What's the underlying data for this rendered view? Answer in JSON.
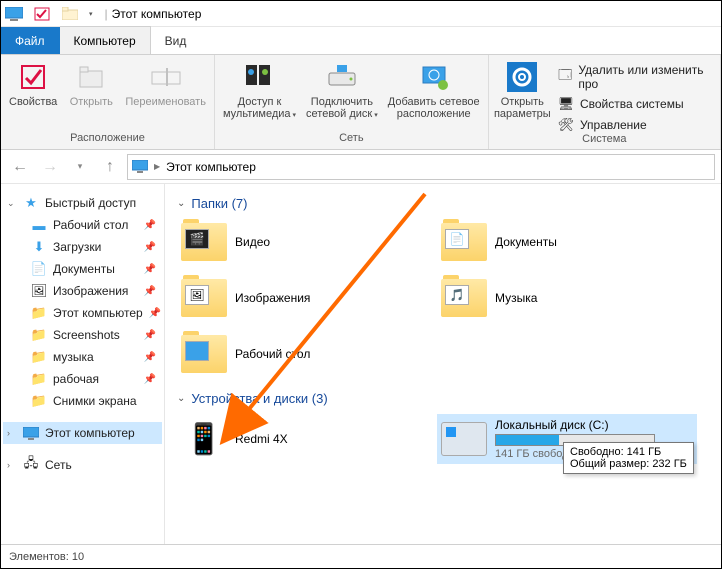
{
  "title": "Этот компьютер",
  "tabs": {
    "file": "Файл",
    "computer": "Компьютер",
    "view": "Вид"
  },
  "ribbon": {
    "group1": {
      "props": "Свойства",
      "open": "Открыть",
      "rename": "Переименовать",
      "label": "Расположение"
    },
    "group2": {
      "media": "Доступ к\nмультимедиа",
      "netdrive": "Подключить\nсетевой диск",
      "addnet": "Добавить сетевое\nрасположение",
      "label": "Сеть"
    },
    "group3": {
      "settings": "Открыть\nпараметры",
      "a": "Удалить или изменить про",
      "b": "Свойства системы",
      "c": "Управление",
      "label": "Система"
    }
  },
  "addr": {
    "root": "Этот компьютер"
  },
  "nav": {
    "quick": "Быстрый доступ",
    "desktop": "Рабочий стол",
    "downloads": "Загрузки",
    "documents": "Документы",
    "pictures": "Изображения",
    "thispc_link": "Этот компьютер",
    "screenshots": "Screenshots",
    "music": "музыка",
    "work": "рабочая",
    "snips": "Снимки экрана",
    "thispc": "Этот компьютер",
    "network": "Сеть"
  },
  "sections": {
    "folders": "Папки (7)",
    "devices": "Устройства и диски (3)"
  },
  "folders": {
    "videos": "Видео",
    "documents": "Документы",
    "pictures": "Изображения",
    "music": "Музыка",
    "desktop": "Рабочий стол"
  },
  "device": {
    "name": "Redmi 4X"
  },
  "drive": {
    "name": "Локальный диск (C:)",
    "free_line": "141 ГБ свободно",
    "fill_pct": 40
  },
  "tooltip": {
    "l1": "Свободно: 141 ГБ",
    "l2": "Общий размер: 232 ГБ"
  },
  "status": {
    "count": "Элементов: 10"
  }
}
